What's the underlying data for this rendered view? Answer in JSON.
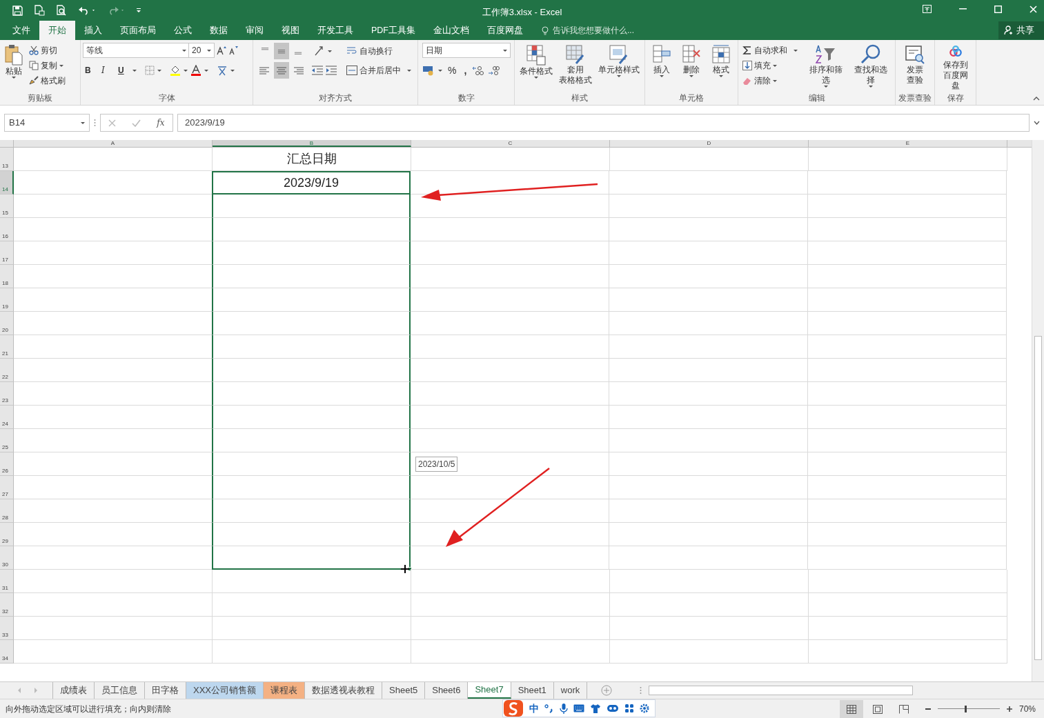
{
  "window": {
    "title": "工作簿3.xlsx - Excel"
  },
  "menu_tabs": [
    {
      "label": "文件",
      "selected": false
    },
    {
      "label": "开始",
      "selected": true
    },
    {
      "label": "插入",
      "selected": false
    },
    {
      "label": "页面布局",
      "selected": false
    },
    {
      "label": "公式",
      "selected": false
    },
    {
      "label": "数据",
      "selected": false
    },
    {
      "label": "审阅",
      "selected": false
    },
    {
      "label": "视图",
      "selected": false
    },
    {
      "label": "开发工具",
      "selected": false
    },
    {
      "label": "PDF工具集",
      "selected": false
    },
    {
      "label": "金山文档",
      "selected": false
    },
    {
      "label": "百度网盘",
      "selected": false
    }
  ],
  "tell_me": {
    "placeholder": "告诉我您想要做什么..."
  },
  "share": "共享",
  "ribbon": {
    "clipboard": {
      "title": "剪贴板",
      "paste": "粘贴",
      "cut": "剪切",
      "copy": "复制",
      "format_painter": "格式刷"
    },
    "font": {
      "title": "字体",
      "font_name": "等线",
      "font_size": "20",
      "bold": "B",
      "italic": "I",
      "underline": "U"
    },
    "alignment": {
      "title": "对齐方式",
      "wrap_text": "自动换行",
      "merge_center": "合并后居中"
    },
    "number": {
      "title": "数字",
      "format": "日期",
      "percent": "%",
      "comma": ","
    },
    "styles": {
      "title": "样式",
      "conditional": "条件格式",
      "table_format": [
        "套用",
        "表格格式"
      ],
      "cell_styles": "单元格样式"
    },
    "cells": {
      "title": "单元格",
      "insert": "插入",
      "delete": "删除",
      "format": "格式"
    },
    "editing": {
      "title": "编辑",
      "autosum": "自动求和",
      "fill": "填充",
      "clear": "清除",
      "sort_filter": "排序和筛选",
      "find_select": "查找和选择"
    },
    "invoice": {
      "title": "发票查验",
      "check": [
        "发票",
        "查验"
      ]
    },
    "save": {
      "title": "保存",
      "save_to": [
        "保存到",
        "百度网盘"
      ]
    }
  },
  "formula_bar": {
    "name_box": "B14",
    "fx": "fx",
    "value": "2023/9/19"
  },
  "columns": [
    {
      "label": "A",
      "selected": false
    },
    {
      "label": "B",
      "selected": true
    },
    {
      "label": "C",
      "selected": false
    },
    {
      "label": "D",
      "selected": false
    },
    {
      "label": "E",
      "selected": false
    }
  ],
  "rows": [
    {
      "header": "13",
      "selected": false,
      "in_fill_range": false,
      "column_b": "汇总日期"
    },
    {
      "header": "14",
      "selected": true,
      "in_fill_range": true,
      "column_b": "2023/9/19"
    },
    {
      "header": "15",
      "selected": false,
      "in_fill_range": true
    },
    {
      "header": "16",
      "selected": false,
      "in_fill_range": true
    },
    {
      "header": "17",
      "selected": false,
      "in_fill_range": true
    },
    {
      "header": "18",
      "selected": false,
      "in_fill_range": true
    },
    {
      "header": "19",
      "selected": false,
      "in_fill_range": true
    },
    {
      "header": "20",
      "selected": false,
      "in_fill_range": true
    },
    {
      "header": "21",
      "selected": false,
      "in_fill_range": true
    },
    {
      "header": "22",
      "selected": false,
      "in_fill_range": true
    },
    {
      "header": "23",
      "selected": false,
      "in_fill_range": true
    },
    {
      "header": "24",
      "selected": false,
      "in_fill_range": true
    },
    {
      "header": "25",
      "selected": false,
      "in_fill_range": true
    },
    {
      "header": "26",
      "selected": false,
      "in_fill_range": true
    },
    {
      "header": "27",
      "selected": false,
      "in_fill_range": true
    },
    {
      "header": "28",
      "selected": false,
      "in_fill_range": true
    },
    {
      "header": "29",
      "selected": false,
      "in_fill_range": true
    },
    {
      "header": "30",
      "selected": false,
      "in_fill_range": true
    },
    {
      "header": "31",
      "selected": false,
      "in_fill_range": false
    },
    {
      "header": "32",
      "selected": false,
      "in_fill_range": false
    },
    {
      "header": "33",
      "selected": false,
      "in_fill_range": false
    },
    {
      "header": "34",
      "selected": false,
      "in_fill_range": false
    }
  ],
  "fill_tooltip": "2023/10/5",
  "sheet_tabs": [
    {
      "label": "成绩表",
      "selected": false
    },
    {
      "label": "员工信息",
      "selected": false
    },
    {
      "label": "田字格",
      "selected": false
    },
    {
      "label": "XXX公司销售额",
      "selected": false,
      "color": "#bdd7ee"
    },
    {
      "label": "课程表",
      "selected": false,
      "color": "#f4b183"
    },
    {
      "label": "数据透视表教程",
      "selected": false
    },
    {
      "label": "Sheet5",
      "selected": false
    },
    {
      "label": "Sheet6",
      "selected": false
    },
    {
      "label": "Sheet7",
      "selected": true
    },
    {
      "label": "Sheet1",
      "selected": false
    },
    {
      "label": "work",
      "selected": false
    }
  ],
  "status_bar": {
    "message": "向外拖动选定区域可以进行填充；向内则清除",
    "zoom_slider": {
      "level": 0.45
    },
    "zoom": "70%"
  },
  "ime_bar": {
    "mode": "中"
  }
}
